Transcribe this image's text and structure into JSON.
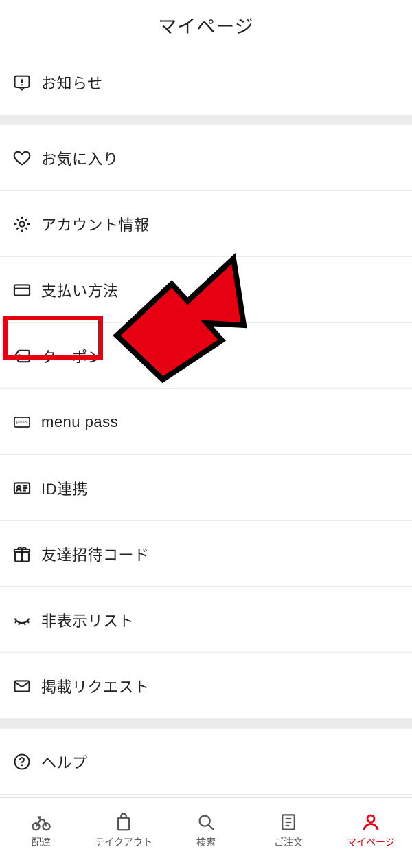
{
  "header": {
    "title": "マイページ"
  },
  "menu": {
    "notifications": "お知らせ",
    "favorites": "お気に入り",
    "account": "アカウント情報",
    "payment": "支払い方法",
    "coupon": "クーポン",
    "menupass": "menu pass",
    "idlink": "ID連携",
    "invite": "友達招待コード",
    "hiddenlist": "非表示リスト",
    "postrequest": "掲載リクエスト",
    "help": "ヘルプ"
  },
  "tabs": {
    "delivery": "配達",
    "takeout": "テイクアウト",
    "search": "検索",
    "orders": "ご注文",
    "mypage": "マイページ"
  },
  "annotation": {
    "highlight_target": "coupon",
    "arrow_color": "#e60012",
    "arrow_stroke": "#000000"
  }
}
